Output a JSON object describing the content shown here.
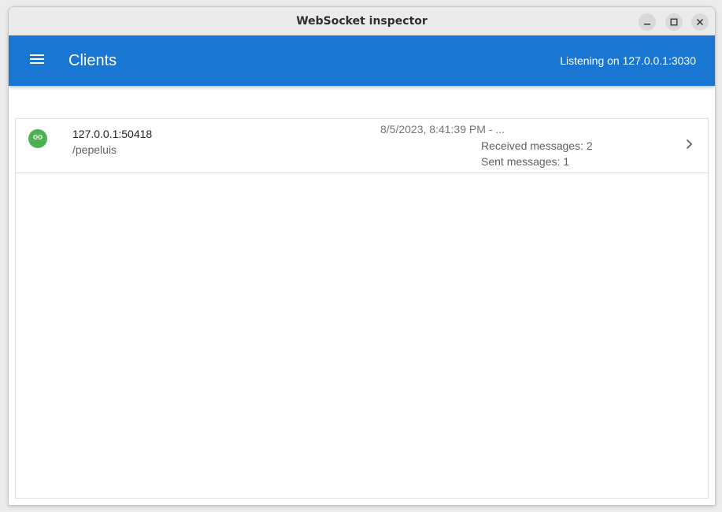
{
  "window": {
    "title": "WebSocket inspector",
    "controls": {
      "minimize_icon": "minimize-icon",
      "maximize_icon": "maximize-icon",
      "close_icon": "close-icon"
    }
  },
  "appbar": {
    "menu_icon": "menu-icon",
    "title": "Clients",
    "status": "Listening on 127.0.0.1:3030",
    "color": "#1976d2"
  },
  "clients": [
    {
      "status_icon": "link-icon",
      "status_color": "#4caf50",
      "address": "127.0.0.1:50418",
      "path": "/pepeluis",
      "time": "8/5/2023, 8:41:39 PM - ...",
      "received": "Received messages: 2",
      "sent": "Sent messages: 1",
      "action_icon": "chevron-right-icon"
    }
  ]
}
